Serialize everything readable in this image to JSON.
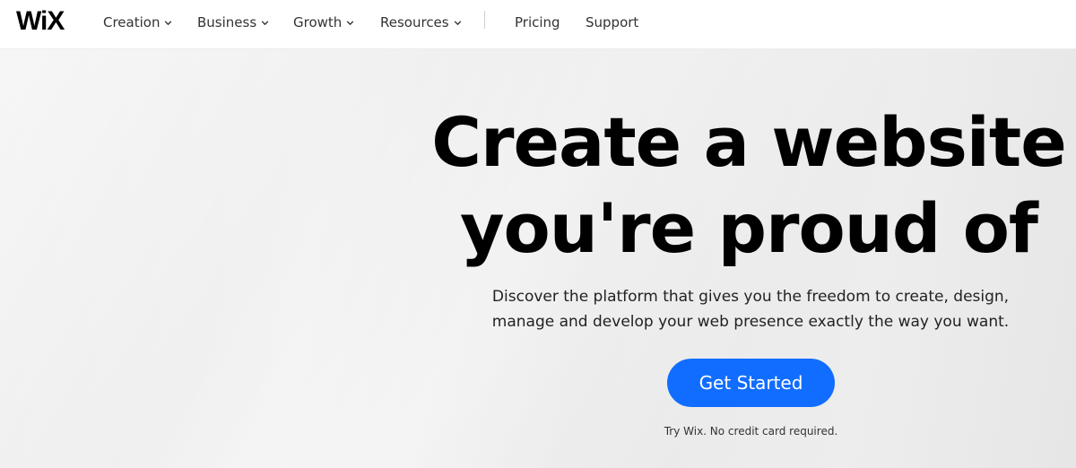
{
  "header": {
    "logo": "WiX",
    "nav": [
      {
        "label": "Creation",
        "has_dropdown": true
      },
      {
        "label": "Business",
        "has_dropdown": true
      },
      {
        "label": "Growth",
        "has_dropdown": true
      },
      {
        "label": "Resources",
        "has_dropdown": true
      },
      {
        "label": "Pricing",
        "has_dropdown": false
      },
      {
        "label": "Support",
        "has_dropdown": false
      }
    ]
  },
  "hero": {
    "headline_line1": "Create a website",
    "headline_line2": "you're proud of",
    "subtitle_line1": "Discover the platform that gives you the freedom to create, design,",
    "subtitle_line2": "manage and develop your web presence exactly the way you want.",
    "cta_label": "Get Started",
    "note": "Try Wix. No credit card required."
  },
  "colors": {
    "accent": "#116dff",
    "text": "#000000",
    "hero_background": "#ececec"
  },
  "icons": {
    "dropdown": "chevron-down-icon"
  }
}
